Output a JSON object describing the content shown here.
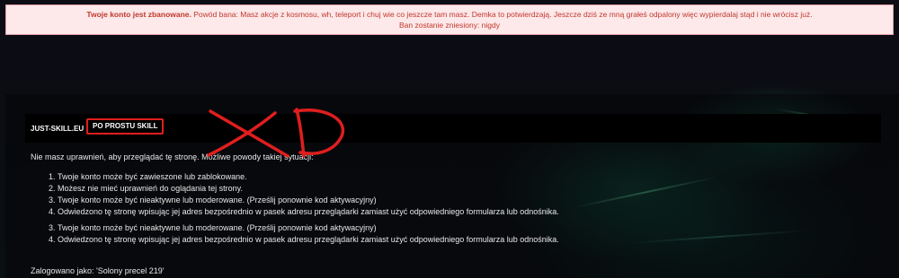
{
  "ban": {
    "title": "Twoje konto jest zbanowane.",
    "reason": "Powód bana: Masz akcje z kosmosu, wh, teleport i chuj wie co jeszcze tam masz. Demka to potwierdzają. Jeszcze dziś ze mną grałeś odpalony więc wypierdalaj stąd i nie wrócisz już.",
    "expiry": "Ban zostanie zniesiony: nigdy"
  },
  "navbar": {
    "site": "JUST-SKILL.EU",
    "separator": "›",
    "crumb": "PO PROSTU SKILL"
  },
  "content": {
    "intro": "Nie masz uprawnień, aby przeglądać tę stronę. Możliwe powody takiej sytuacji:",
    "reasons": [
      "Twoje konto może być zawieszone lub zablokowane.",
      "Możesz nie mieć uprawnień do oglądania tej strony.",
      "Twoje konto może być nieaktywne lub moderowane. (Prześlij ponownie kod aktywacyjny)",
      "Odwiedzono tę stronę wpisując jej adres bezpośrednio w pasek adresu przeglądarki zamiast użyć odpowiedniego formularza lub odnośnika."
    ],
    "reasons_repeat": [
      "Twoje konto może być nieaktywne lub moderowane. (Prześlij ponownie kod aktywacyjny)",
      "Odwiedzono tę stronę wpisując jej adres bezpośrednio w pasek adresu przeglądarki zamiast użyć odpowiedniego formularza lub odnośnika."
    ],
    "reasons_repeat_start": 3
  },
  "footer": {
    "logged_in": "Zalogowano jako: 'Solony precel 219'"
  },
  "colors": {
    "ban_background": "#fde8ea",
    "ban_text": "#c0392b",
    "annotation_red": "#e01e1e"
  },
  "annotation": {
    "icon": "scribbled-xd-icon"
  }
}
